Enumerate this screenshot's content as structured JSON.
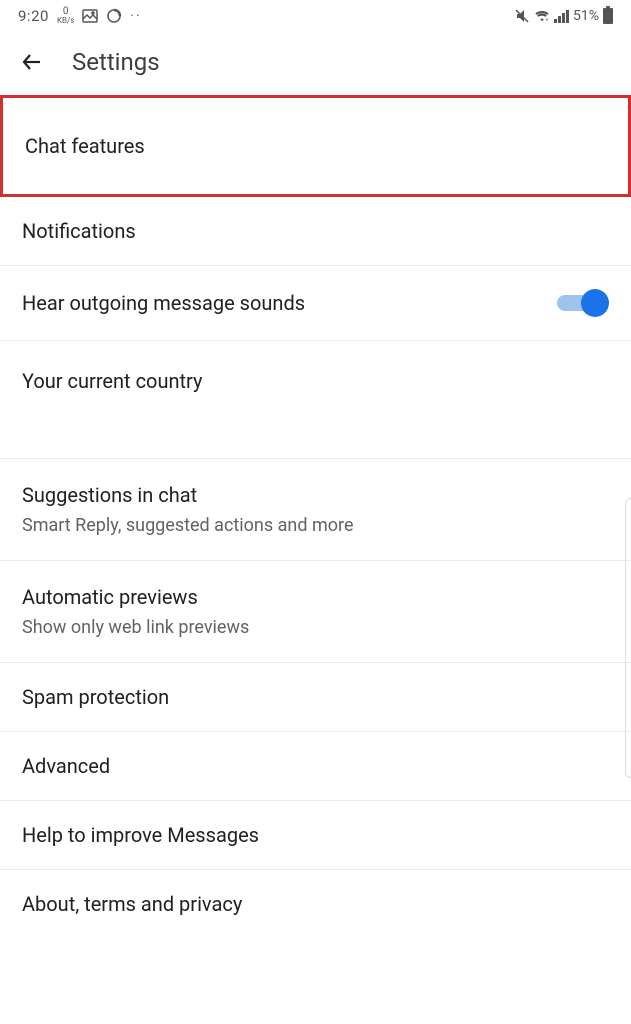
{
  "status_bar": {
    "time": "9:20",
    "kbs_top": "0",
    "kbs_bottom": "KB/s",
    "battery_pct": "51%",
    "dots": "··"
  },
  "header": {
    "title": "Settings"
  },
  "items": {
    "chat_features": "Chat features",
    "notifications": "Notifications",
    "hear_sounds": "Hear outgoing message sounds",
    "current_country": "Your current country",
    "suggestions_title": "Suggestions in chat",
    "suggestions_sub": "Smart Reply, suggested actions and more",
    "auto_previews_title": "Automatic previews",
    "auto_previews_sub": "Show only web link previews",
    "spam": "Spam protection",
    "advanced": "Advanced",
    "help_improve": "Help to improve Messages",
    "about": "About, terms and privacy"
  },
  "toggle": {
    "hear_sounds_on": true
  }
}
